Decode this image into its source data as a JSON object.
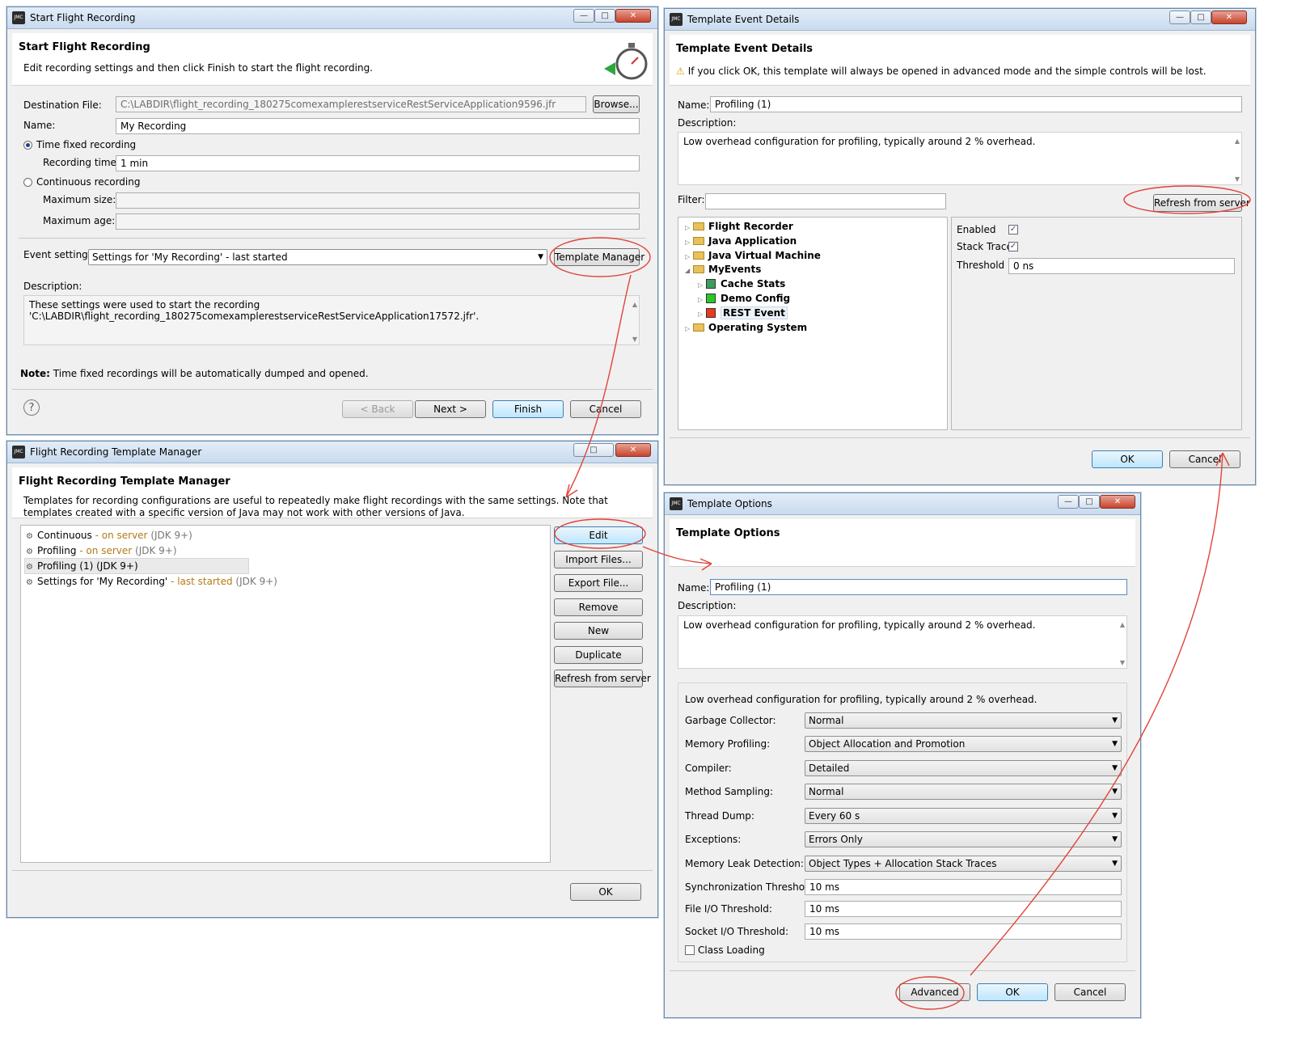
{
  "start": {
    "title": "Start Flight Recording",
    "header_title": "Start Flight Recording",
    "header_desc": "Edit recording settings and then click Finish to start the flight recording.",
    "dest_label": "Destination File:",
    "dest_value": "C:\\LABDIR\\flight_recording_180275comexamplerestserviceRestServiceApplication9596.jfr",
    "browse": "Browse...",
    "name_label": "Name:",
    "name_value": "My Recording",
    "time_fixed": "Time fixed recording",
    "rec_time_label": "Recording time:",
    "rec_time_value": "1 min",
    "continuous": "Continuous recording",
    "max_size": "Maximum size:",
    "max_age": "Maximum age:",
    "event_settings_label": "Event settings:",
    "event_settings_value": "Settings for 'My Recording' - last started",
    "template_manager": "Template Manager",
    "desc_label": "Description:",
    "desc_value": "These settings were used to start the recording 'C:\\LABDIR\\flight_recording_180275comexamplerestserviceRestServiceApplication17572.jfr'.",
    "note_bold": "Note:",
    "note_text": " Time fixed recordings will be automatically dumped and opened.",
    "back": "< Back",
    "next": "Next >",
    "finish": "Finish",
    "cancel": "Cancel"
  },
  "manager": {
    "title": "Flight Recording Template Manager",
    "header_title": "Flight Recording Template Manager",
    "header_desc1": "Templates for recording configurations are useful to repeatedly make flight recordings with the same settings. Note that",
    "header_desc2": "templates created with a specific version of Java may not work with other versions of Java.",
    "templates": [
      {
        "name": "Continuous",
        "source": " - on server",
        "jdk": " (JDK 9+)"
      },
      {
        "name": "Profiling",
        "source": " - on server",
        "jdk": " (JDK 9+)"
      },
      {
        "name": "Profiling (1)",
        "source": "",
        "jdk": " (JDK 9+)"
      },
      {
        "name": "Settings for 'My Recording'",
        "source": " - last started",
        "jdk": " (JDK 9+)"
      }
    ],
    "buttons": {
      "edit": "Edit",
      "import": "Import Files...",
      "export": "Export File...",
      "remove": "Remove",
      "new": "New",
      "duplicate": "Duplicate",
      "refresh": "Refresh from server",
      "ok": "OK"
    }
  },
  "event_details": {
    "title": "Template Event Details",
    "header_title": "Template Event Details",
    "warning": "If you click OK, this template will always be opened in advanced mode and the simple controls will be lost.",
    "name_label": "Name:",
    "name_value": "Profiling (1)",
    "desc_label": "Description:",
    "desc_value": "Low overhead configuration for profiling, typically around 2 % overhead.",
    "filter_label": "Filter:",
    "refresh": "Refresh from server",
    "tree": {
      "flight_recorder": "Flight Recorder",
      "java_application": "Java Application",
      "jvm": "Java Virtual Machine",
      "my_events": "MyEvents",
      "cache_stats": "Cache Stats",
      "demo_config": "Demo Config",
      "rest_event": "REST Event",
      "os": "Operating System"
    },
    "enabled": "Enabled",
    "stack_trace": "Stack Trace",
    "threshold": "Threshold",
    "threshold_value": "0 ns",
    "ok": "OK",
    "cancel": "Cancel",
    "colors": {
      "cache_stats": "#3d9c5e",
      "demo_config": "#28c828",
      "rest_event": "#e83a1c"
    }
  },
  "options": {
    "title": "Template Options",
    "header_title": "Template Options",
    "name_label": "Name:",
    "name_value": "Profiling (1)",
    "desc_label": "Description:",
    "desc_value": "Low overhead configuration for profiling, typically around 2 % overhead.",
    "summary": "Low overhead configuration for profiling, typically around 2 % overhead.",
    "rows": [
      {
        "label": "Garbage Collector:",
        "value": "Normal"
      },
      {
        "label": "Memory Profiling:",
        "value": "Object Allocation and Promotion"
      },
      {
        "label": "Compiler:",
        "value": "Detailed"
      },
      {
        "label": "Method Sampling:",
        "value": "Normal"
      },
      {
        "label": "Thread Dump:",
        "value": "Every 60 s"
      },
      {
        "label": "Exceptions:",
        "value": "Errors Only"
      },
      {
        "label": "Memory Leak Detection:",
        "value": "Object Types + Allocation Stack Traces"
      }
    ],
    "sync_label": "Synchronization Threshold:",
    "sync_value": "10 ms",
    "file_io_label": "File I/O Threshold:",
    "file_io_value": "10 ms",
    "socket_io_label": "Socket I/O Threshold:",
    "socket_io_value": "10 ms",
    "class_loading": "Class Loading",
    "advanced": "Advanced",
    "ok": "OK",
    "cancel": "Cancel"
  }
}
